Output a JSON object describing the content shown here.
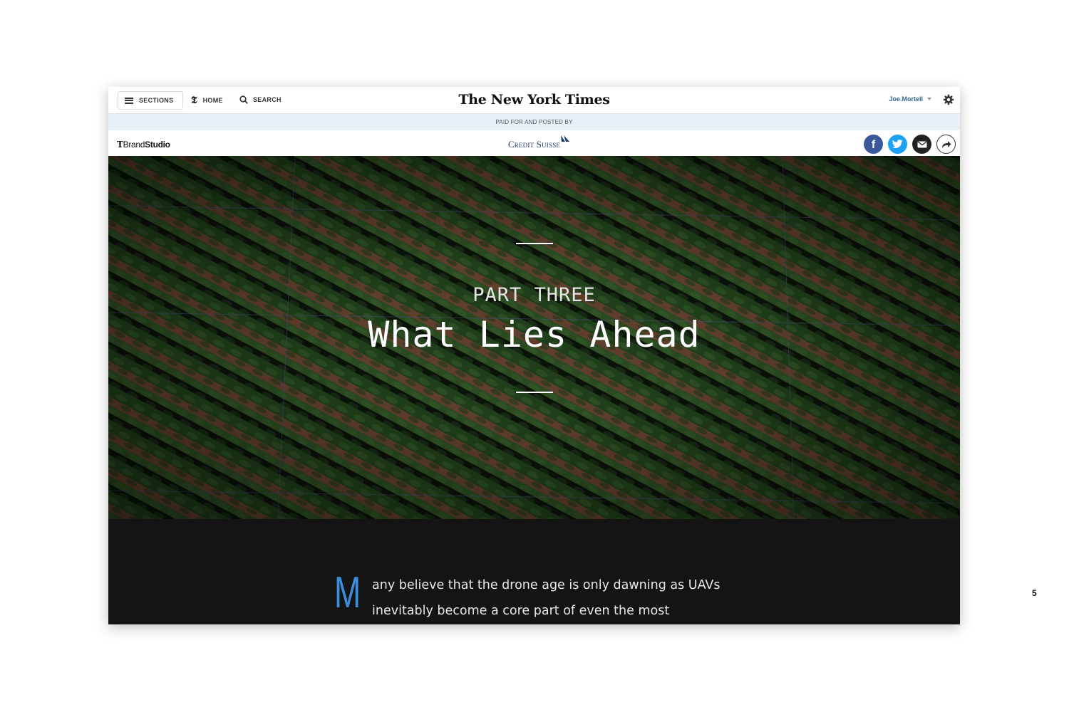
{
  "nav": {
    "sections_label": "SECTIONS",
    "home_label": "HOME",
    "search_label": "SEARCH",
    "masthead": "The New York Times",
    "user_name": "Joe.Mortell"
  },
  "paid_strip": {
    "text": "PAID FOR AND POSTED BY"
  },
  "brand_bar": {
    "brandstudio_t": "T",
    "brandstudio_brand": "Brand",
    "brandstudio_studio": "Studio",
    "sponsor": "Credit Suisse",
    "share_icons": [
      "facebook-icon",
      "twitter-icon",
      "email-icon",
      "share-icon"
    ],
    "facebook_glyph": "f"
  },
  "hero": {
    "kicker": "PART THREE",
    "headline": "What Lies Ahead",
    "image": "aerial view of hop field rows"
  },
  "article": {
    "drop_cap": "M",
    "line1": "any believe that the drone age is only dawning as UAVs",
    "line2": "inevitably become a core part of even the most"
  },
  "slide_number": "5",
  "colors": {
    "accent_blue": "#3d8fdd",
    "paid_strip_bg": "#e8f0f7",
    "article_bg": "#141414",
    "facebook": "#3b5998",
    "twitter": "#1da1f2",
    "sponsor_navy": "#1b3a6b"
  }
}
